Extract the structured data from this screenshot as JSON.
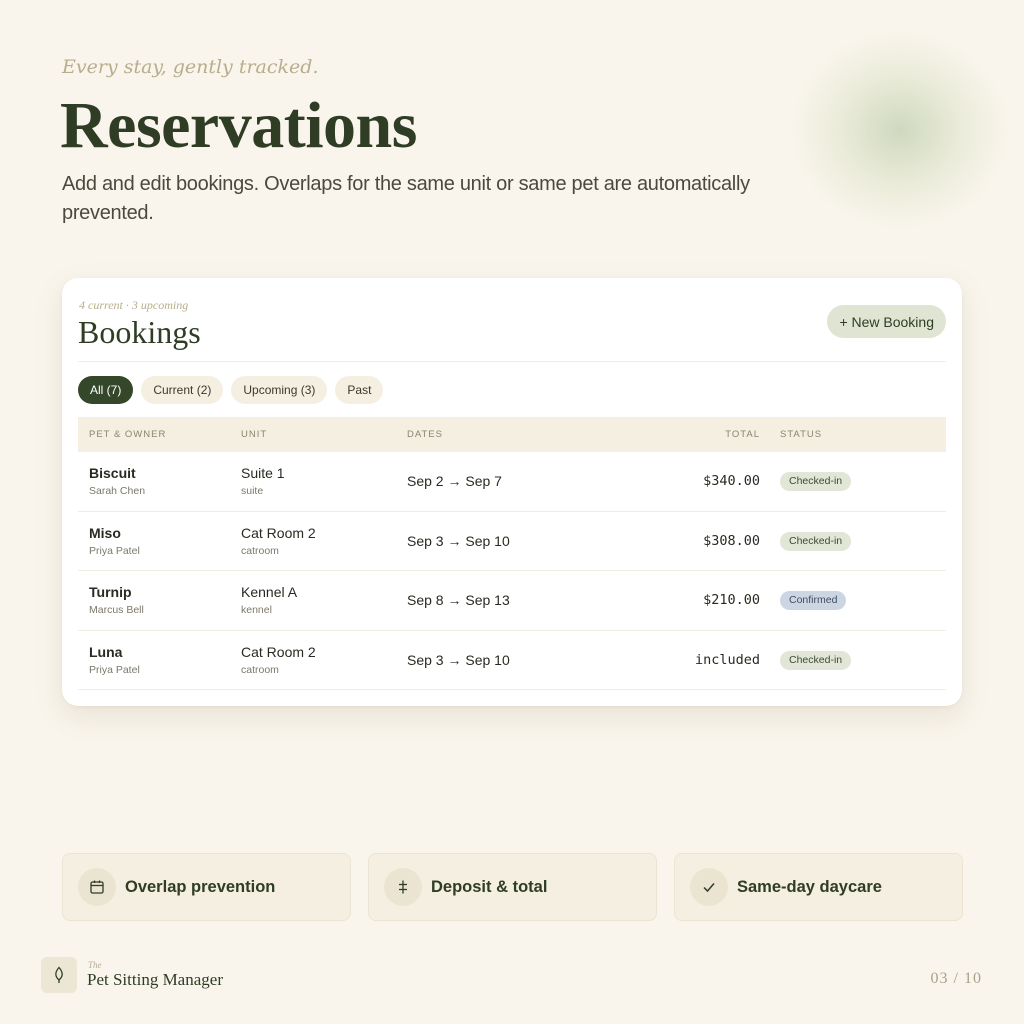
{
  "header": {
    "eyebrow": "Every stay, gently tracked.",
    "title": "Reservations",
    "subtitle": "Add and edit bookings. Overlaps for the same unit or same pet are automatically prevented."
  },
  "card": {
    "meta": "4 current · 3 upcoming",
    "title": "Bookings",
    "new_booking_label": "+ New Booking",
    "filters": [
      "All (7)",
      "Current (2)",
      "Upcoming (3)",
      "Past"
    ],
    "columns": [
      "PET & OWNER",
      "UNIT",
      "DATES",
      "TOTAL",
      "STATUS"
    ],
    "rows": [
      {
        "pet": "Biscuit",
        "owner": "Sarah Chen",
        "unit": "Suite 1",
        "unit_type": "suite",
        "dates": "Sep 2 → Sep 7",
        "total": "$340.00",
        "status": "Checked-in"
      },
      {
        "pet": "Miso",
        "owner": "Priya Patel",
        "unit": "Cat Room 2",
        "unit_type": "catroom",
        "dates": "Sep 3 → Sep 10",
        "total": "$308.00",
        "status": "Checked-in"
      },
      {
        "pet": "Turnip",
        "owner": "Marcus Bell",
        "unit": "Kennel A",
        "unit_type": "kennel",
        "dates": "Sep 8 → Sep 13",
        "total": "$210.00",
        "status": "Confirmed"
      },
      {
        "pet": "Luna",
        "owner": "Priya Patel",
        "unit": "Cat Room 2",
        "unit_type": "catroom",
        "dates": "Sep 3 → Sep 10",
        "total": "included",
        "status": "Checked-in"
      }
    ]
  },
  "features": [
    {
      "label": "Overlap prevention",
      "icon": "calendar-icon"
    },
    {
      "label": "Deposit & total",
      "icon": "dollar-icon"
    },
    {
      "label": "Same-day daycare",
      "icon": "check-icon"
    }
  ],
  "footer": {
    "brand_the": "The",
    "brand_name": "Pet Sitting Manager",
    "brand_icon": "leaf-icon",
    "page": "03 / 10"
  },
  "colors": {
    "background": "#f9f5ec",
    "accent": "#34472a",
    "checked_in_badge": "#e1e6d6",
    "confirmed_badge": "#ccd6e3"
  }
}
